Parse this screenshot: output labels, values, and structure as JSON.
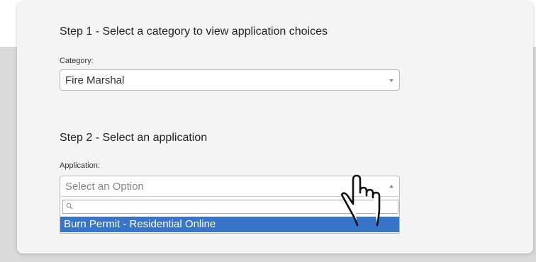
{
  "step1": {
    "title": "Step 1 - Select a category to view application choices",
    "label": "Category:",
    "selected": "Fire Marshal"
  },
  "step2": {
    "title": "Step 2 - Select an application",
    "label": "Application:",
    "placeholder": "Select an Option",
    "search_value": "",
    "options": [
      "Burn Permit - Residential Online"
    ]
  },
  "icons": {
    "search": "search-icon",
    "cursor": "hand-pointer-cursor-icon"
  },
  "colors": {
    "highlight": "#3874c7"
  }
}
